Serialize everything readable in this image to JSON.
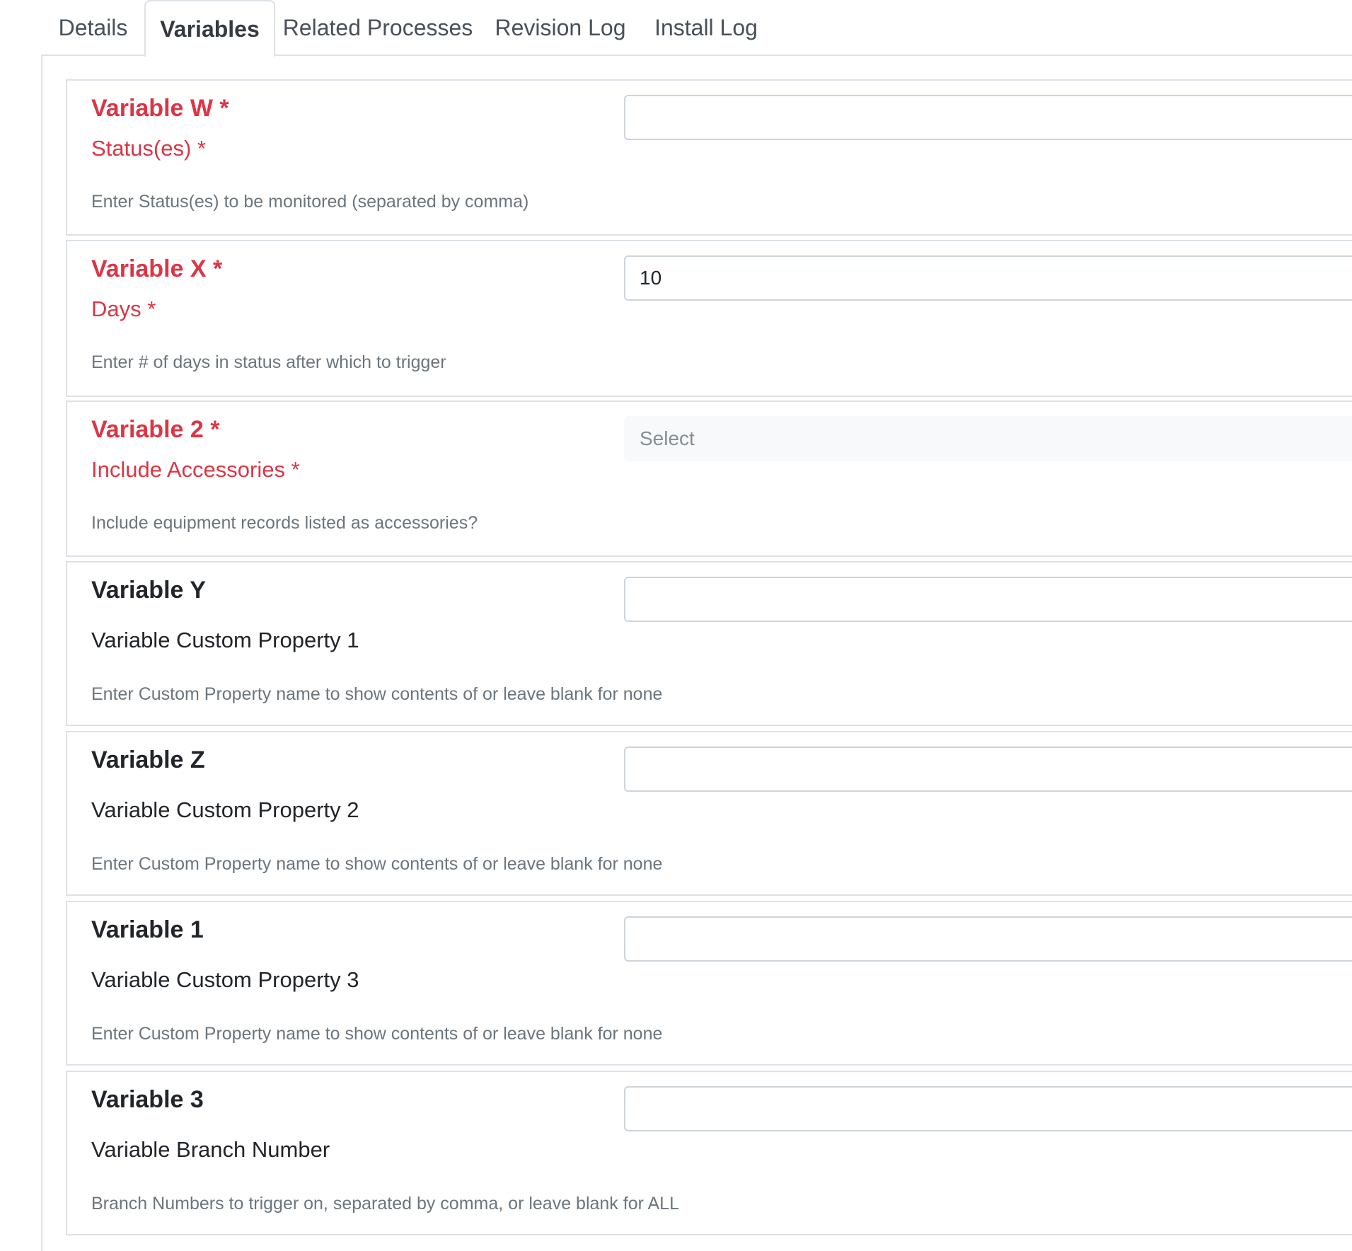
{
  "tabs": [
    {
      "label": "Details"
    },
    {
      "label": "Variables",
      "active": true
    },
    {
      "label": "Related Processes"
    },
    {
      "label": "Revision Log"
    },
    {
      "label": "Install Log"
    }
  ],
  "variables": [
    {
      "title": "Variable W *",
      "label": "Status(es) *",
      "help": "Enter Status(es) to be monitored (separated by comma)",
      "required": true,
      "control": "text",
      "value": ""
    },
    {
      "title": "Variable X *",
      "label": "Days *",
      "help": "Enter # of days in status after which to trigger",
      "required": true,
      "control": "text",
      "value": "10"
    },
    {
      "title": "Variable 2 *",
      "label": "Include Accessories *",
      "help": "Include equipment records listed as accessories?",
      "required": true,
      "control": "select",
      "value": "Select"
    },
    {
      "title": "Variable Y",
      "label": "Variable Custom Property 1",
      "help": "Enter Custom Property name to show contents of or leave blank for none",
      "required": false,
      "control": "text",
      "value": ""
    },
    {
      "title": "Variable Z",
      "label": "Variable Custom Property 2",
      "help": "Enter Custom Property name to show contents of or leave blank for none",
      "required": false,
      "control": "text",
      "value": ""
    },
    {
      "title": "Variable 1",
      "label": "Variable Custom Property 3",
      "help": "Enter Custom Property name to show contents of or leave blank for none",
      "required": false,
      "control": "text",
      "value": ""
    },
    {
      "title": "Variable 3",
      "label": "Variable Branch Number",
      "help": "Branch Numbers to trigger on, separated by comma, or leave blank for ALL",
      "required": false,
      "control": "text",
      "value": ""
    }
  ],
  "colors": {
    "required": "#dc3545",
    "text": "#212529",
    "muted": "#6c757d",
    "border": "#dee2e6"
  }
}
